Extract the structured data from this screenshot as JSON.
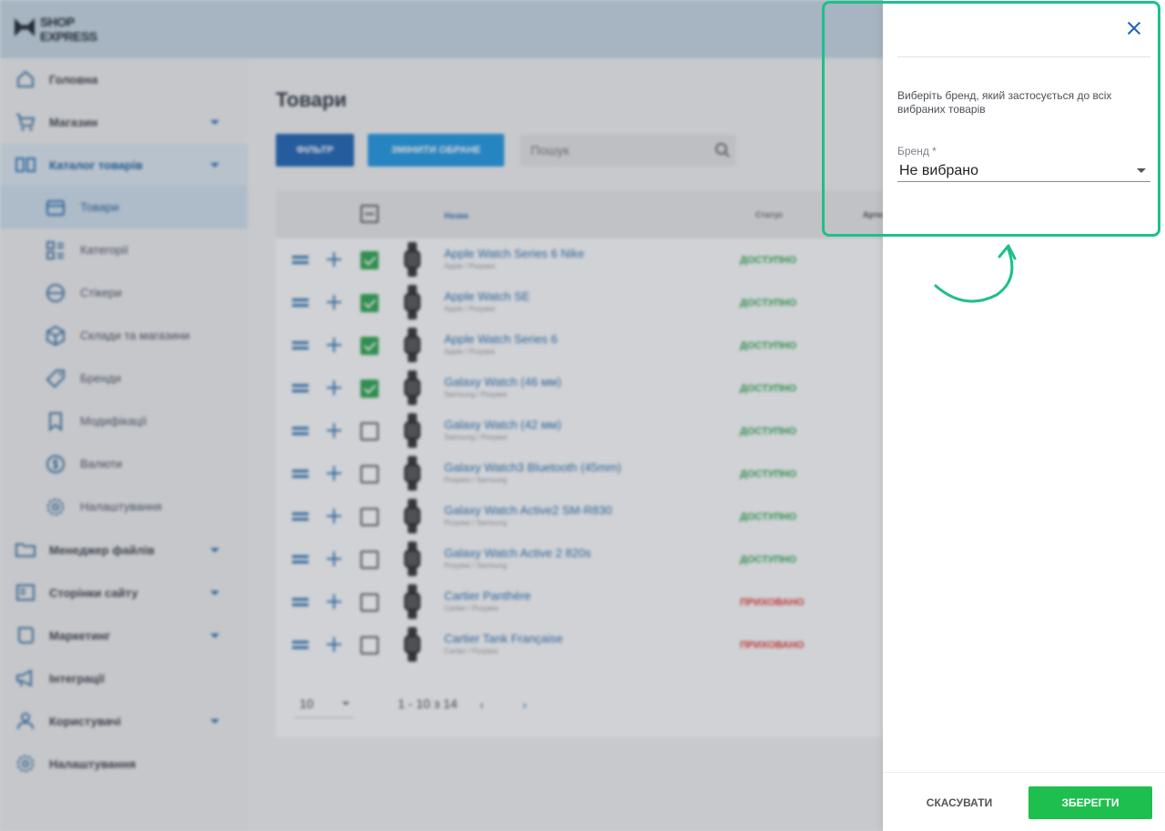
{
  "brand": {
    "line1": "SHOP",
    "line2": "EXPRESS"
  },
  "sidebar": {
    "items": [
      {
        "label": "Головна"
      },
      {
        "label": "Магазин"
      },
      {
        "label": "Каталог товарів"
      },
      {
        "label": "Менеджер файлів"
      },
      {
        "label": "Сторінки сайту"
      },
      {
        "label": "Маркетинг"
      },
      {
        "label": "Інтеграції"
      },
      {
        "label": "Користувачі"
      },
      {
        "label": "Налаштування"
      }
    ],
    "catalog_sub": [
      {
        "label": "Товари"
      },
      {
        "label": "Категорії"
      },
      {
        "label": "Стікери"
      },
      {
        "label": "Склади та магазини"
      },
      {
        "label": "Бренди"
      },
      {
        "label": "Модифікації"
      },
      {
        "label": "Валюти"
      },
      {
        "label": "Налаштування"
      }
    ]
  },
  "main": {
    "title": "Товари",
    "filter_label": "ФІЛЬТР",
    "change_selected_label": "ЗМІНИТИ ОБРАНЕ",
    "search_placeholder": "Пошук",
    "columns": {
      "name": "Назва",
      "status": "Статус",
      "article": "Арти"
    },
    "rows": [
      {
        "name": "Apple Watch Series 6 Nike",
        "sub": "Apple / Розумні",
        "status": "ДОСТУПНО",
        "checked": true
      },
      {
        "name": "Apple Watch SE",
        "sub": "Apple / Розумні",
        "status": "ДОСТУПНО",
        "checked": true
      },
      {
        "name": "Apple Watch Series 6",
        "sub": "Apple / Розумні",
        "status": "ДОСТУПНО",
        "checked": true
      },
      {
        "name": "Galaxy Watch (46 мм)",
        "sub": "Samsung / Розумні",
        "status": "ДОСТУПНО",
        "checked": true
      },
      {
        "name": "Galaxy Watch (42 мм)",
        "sub": "Samsung / Розумні",
        "status": "ДОСТУПНО",
        "checked": false
      },
      {
        "name": "Galaxy Watch3 Bluetooth (45mm)",
        "sub": "Розумні / Samsung",
        "status": "ДОСТУПНО",
        "checked": false
      },
      {
        "name": "Galaxy Watch Active2 SM-R830",
        "sub": "Розумні / Samsung",
        "status": "ДОСТУПНО",
        "checked": false
      },
      {
        "name": "Galaxy Watch Active 2 820s",
        "sub": "Розумні / Samsung",
        "status": "ДОСТУПНО",
        "checked": false
      },
      {
        "name": "Cartier Panthère",
        "sub": "Cartier / Розумні",
        "status": "ПРИХОВАНО",
        "checked": false
      },
      {
        "name": "Cartier Tank Française",
        "sub": "Cartier / Розумні",
        "status": "ПРИХОВАНО",
        "checked": false
      }
    ],
    "pager": {
      "page_size": "10",
      "range": "1 - 10 з 14",
      "prev": "‹",
      "next": "›"
    }
  },
  "drawer": {
    "hint": "Виберіть бренд, який застосується до всіх вибраних товарів",
    "brand_label": "Бренд *",
    "brand_value": "Не вибрано",
    "cancel_label": "СКАСУВАТИ",
    "save_label": "ЗБЕРЕГТИ"
  },
  "colors": {
    "available": "#2ea44f",
    "hidden": "#e53935",
    "primary": "#1f63b3",
    "save": "#1fbf4f",
    "annotation": "#1fbf8a"
  }
}
